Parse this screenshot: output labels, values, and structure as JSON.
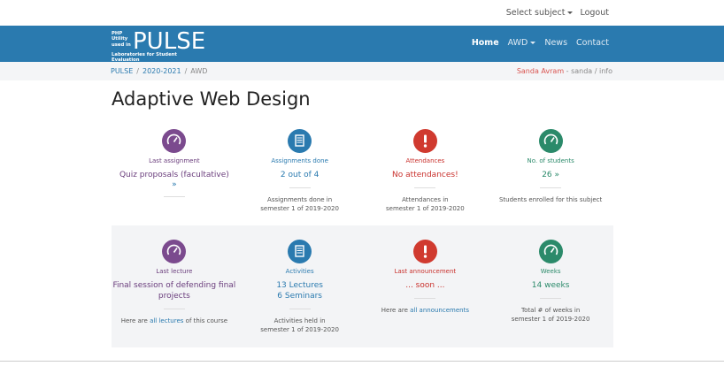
{
  "topbar": {
    "select_subject": "Select subject",
    "logout": "Logout"
  },
  "logo": {
    "small_lines": [
      "PHP",
      "Utility",
      "used in"
    ],
    "big": "PULSE",
    "sub": "Laboratories for Student Evaluation"
  },
  "nav": {
    "home": "Home",
    "awd": "AWD",
    "news": "News",
    "contact": "Contact"
  },
  "breadcrumb": {
    "items": [
      "PULSE",
      "2020-2021",
      "AWD"
    ],
    "user_name": "Sanda Avram",
    "user_rest": " - sanda / info"
  },
  "page_title": "Adaptive Web Design",
  "row1": [
    {
      "label": "Last assignment",
      "value": "Quiz proposals (facultative)",
      "extra": "»",
      "note": ""
    },
    {
      "label": "Assignments done",
      "value": "2 out of 4",
      "extra": "",
      "note_lines": [
        "Assignments done in",
        "semester 1 of 2019-2020"
      ]
    },
    {
      "label": "Attendances",
      "value": "No attendances!",
      "extra": "",
      "note_lines": [
        "Attendances in",
        "semester 1 of 2019-2020"
      ]
    },
    {
      "label": "No. of students",
      "value": "26 »",
      "extra": "",
      "note_lines": [
        "Students enrolled for this subject"
      ]
    }
  ],
  "row2": [
    {
      "label": "Last lecture",
      "value_lines": [
        "Final session of defending final",
        "projects"
      ],
      "note_pre": "Here are ",
      "note_link": "all lectures",
      "note_post": " of this course"
    },
    {
      "label": "Activities",
      "value_lines": [
        "13 Lectures",
        "6 Seminars"
      ],
      "note_lines": [
        "Activities held in",
        "semester 1 of 2019-2020"
      ]
    },
    {
      "label": "Last announcement",
      "value_lines": [
        "... soon ..."
      ],
      "note_pre": "Here are ",
      "note_link": "all announcements",
      "note_post": ""
    },
    {
      "label": "Weeks",
      "value_lines": [
        "14 weeks"
      ],
      "note_lines": [
        "Total # of weeks in",
        "semester 1 of 2019-2020"
      ]
    }
  ],
  "colors": {
    "navbar": "#2a7aaf",
    "purple": "#7b4a8e",
    "red": "#d03a2f",
    "green": "#2b8a6a"
  },
  "icons": [
    "gauge-icon",
    "document-icon",
    "exclamation-icon",
    "gauge-icon"
  ]
}
